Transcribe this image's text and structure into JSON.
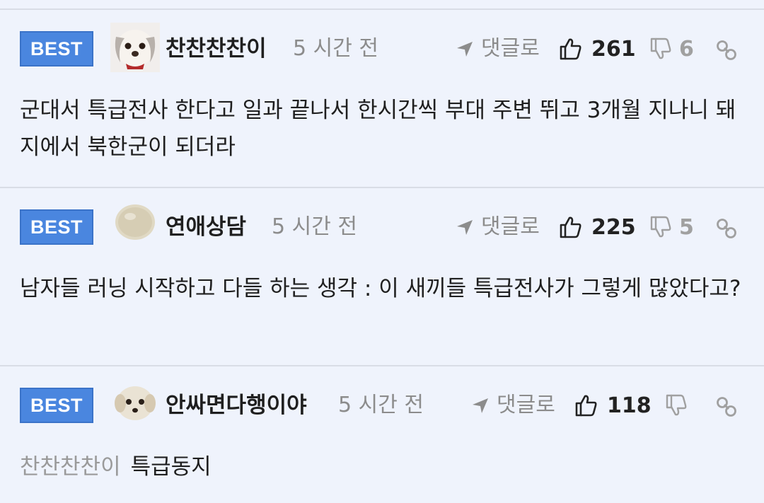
{
  "comments": [
    {
      "badge": "BEST",
      "username": "찬찬찬찬이",
      "time": "5 시간 전",
      "reply_label": "댓글로",
      "likes": "261",
      "dislikes": "6",
      "mention": "",
      "text": "군대서 특급전사 한다고 일과 끝나서 한시간씩 부대 주변 뛰고 3개월 지나니 돼지에서 북한군이 되더라"
    },
    {
      "badge": "BEST",
      "username": "연애상담",
      "time": "5 시간 전",
      "reply_label": "댓글로",
      "likes": "225",
      "dislikes": "5",
      "mention": "",
      "text": "남자들 러닝 시작하고 다들 하는 생각 : 이 새끼들 특급전사가 그렇게 많았다고?"
    },
    {
      "badge": "BEST",
      "username": "안싸면다행이야",
      "time": "5 시간 전",
      "reply_label": "댓글로",
      "likes": "118",
      "dislikes": "",
      "mention": "찬찬찬찬이",
      "text": "특급동지"
    }
  ],
  "colors": {
    "background": "#eff3fc",
    "badge": "#4a86df",
    "muted": "#8c8c8c"
  },
  "icons": [
    "thumbs-up-icon",
    "thumbs-down-icon",
    "link-icon",
    "reply-arrow-icon"
  ]
}
